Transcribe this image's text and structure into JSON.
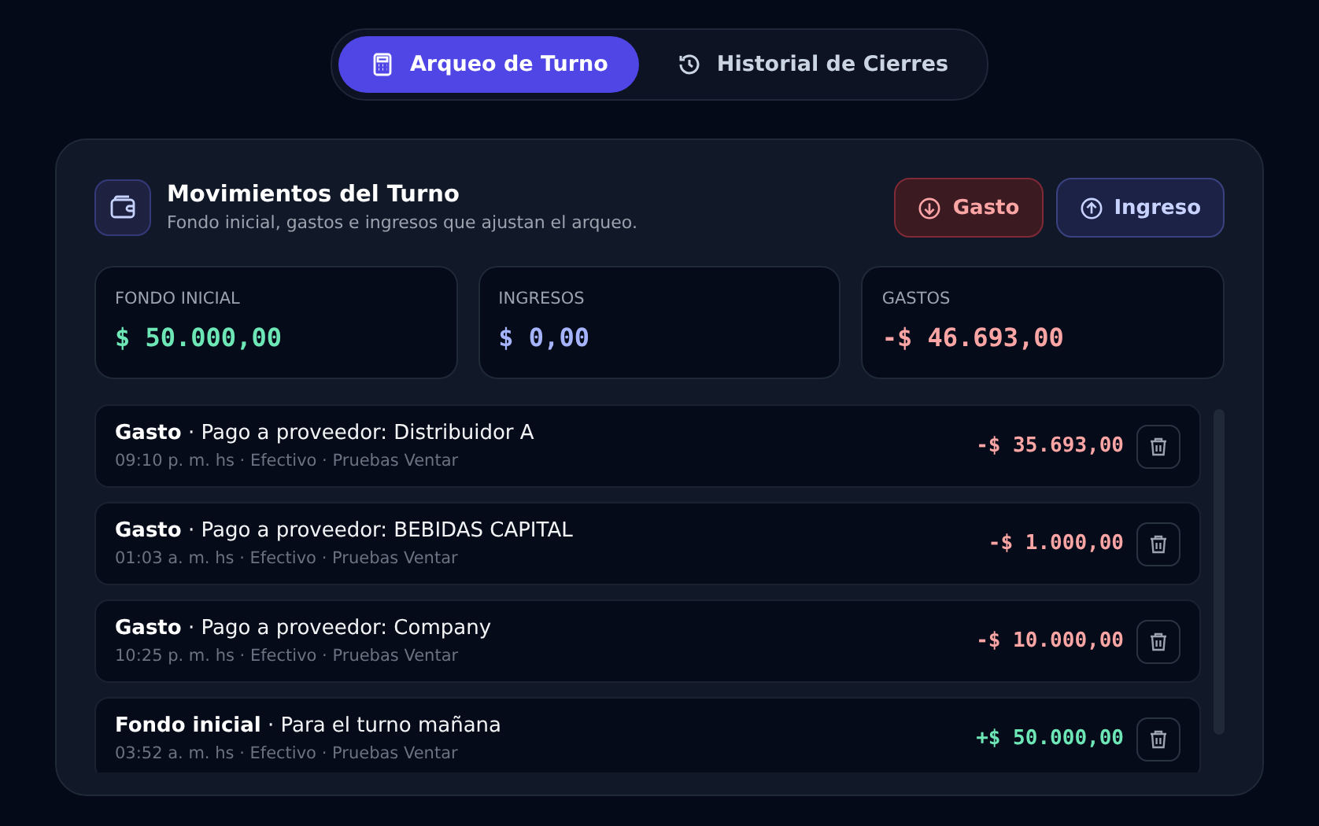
{
  "tabs": [
    {
      "label": "Arqueo de Turno",
      "selected": true
    },
    {
      "label": "Historial de Cierres",
      "selected": false
    }
  ],
  "panel": {
    "title": "Movimientos del Turno",
    "subtitle": "Fondo inicial, gastos e ingresos que ajustan el arqueo.",
    "buttons": [
      {
        "label": "Gasto",
        "kind": "expense"
      },
      {
        "label": "Ingreso",
        "kind": "income"
      }
    ],
    "stats": [
      {
        "label": "FONDO INICIAL",
        "value": "$ 50.000,00",
        "kind": "fund"
      },
      {
        "label": "INGRESOS",
        "value": "$ 0,00",
        "kind": "income"
      },
      {
        "label": "GASTOS",
        "value": "-$ 46.693,00",
        "kind": "expense"
      }
    ],
    "movements": [
      {
        "title": "**Gasto** · Pago a proveedor: Distribuidor A",
        "meta": "09:10 p. m. hs · Efectivo · Pruebas Ventar",
        "amount": "-$ 35.693,00",
        "kind": "expense"
      },
      {
        "title": "**Gasto** · Pago a proveedor: BEBIDAS CAPITAL",
        "meta": "01:03 a. m. hs · Efectivo · Pruebas Ventar",
        "amount": "-$ 1.000,00",
        "kind": "expense"
      },
      {
        "title": "**Gasto** · Pago a proveedor: Company",
        "meta": "10:25 p. m. hs · Efectivo · Pruebas Ventar",
        "amount": "-$ 10.000,00",
        "kind": "expense"
      },
      {
        "title": "**Fondo inicial** · Para el turno mañana",
        "meta": "03:52 a. m. hs · Efectivo · Pruebas Ventar",
        "amount": "+$ 50.000,00",
        "kind": "fund"
      }
    ]
  }
}
